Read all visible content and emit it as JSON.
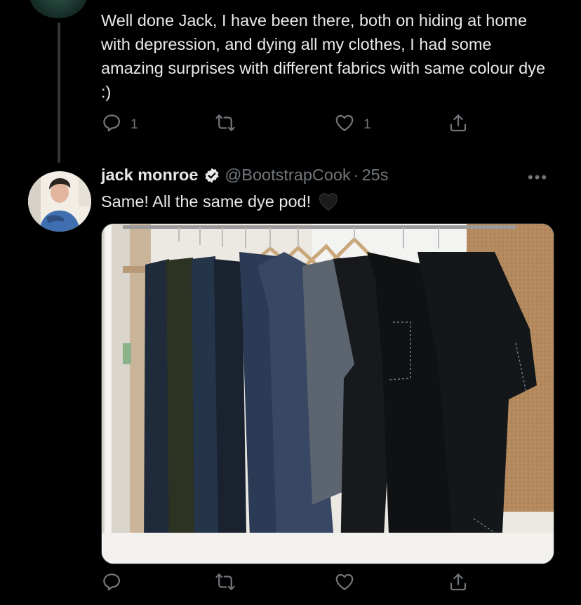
{
  "reply": {
    "text": "Well done Jack, I have been there, both on hiding at home with depression, and dying all my clothes, I had some amazing surprises with different fabrics with same colour dye :)",
    "reply_count": "1",
    "retweet_count": "",
    "like_count": "1"
  },
  "tweet": {
    "display_name": "jack monroe",
    "handle": "@BootstrapCook",
    "separator": "·",
    "time": "25s",
    "more_label": "•••",
    "text": "Same! All the same dye pod!",
    "emoji": "🖤",
    "image_alt": "Clothes on hangers, all dyed black"
  },
  "icons": {
    "reply": "reply-icon",
    "retweet": "retweet-icon",
    "like": "heart-icon",
    "share": "share-icon",
    "verified": "verified-badge-icon"
  },
  "colors": {
    "background": "#000000",
    "text": "#e7e9ea",
    "muted": "#71767b",
    "thread_line": "#333639"
  }
}
